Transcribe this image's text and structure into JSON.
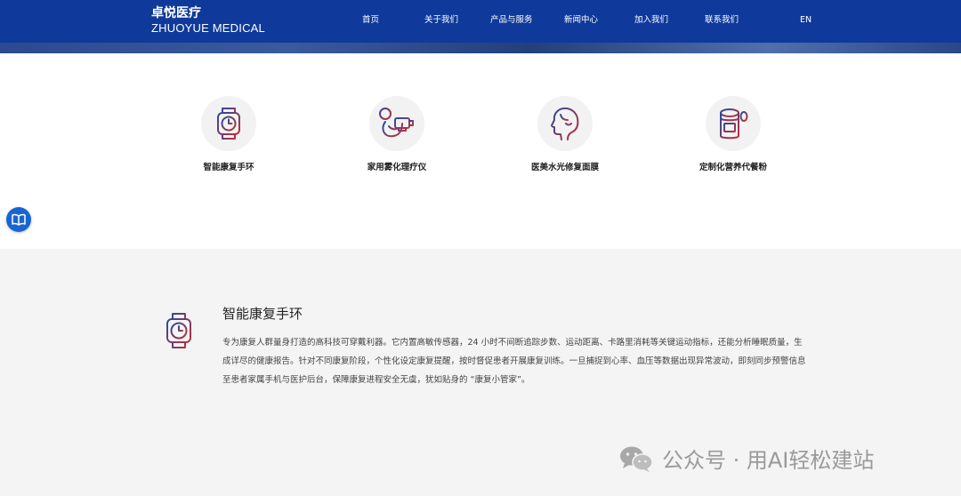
{
  "header": {
    "logo_cn": "卓悦医疗",
    "logo_en": "ZHUOYUE MEDICAL",
    "nav": [
      "首页",
      "关于我们",
      "产品与服务",
      "新闻中心",
      "加入我们",
      "联系我们",
      "EN"
    ]
  },
  "products": [
    {
      "label": "智能康复手环",
      "icon": "watch-icon"
    },
    {
      "label": "家用雾化理疗仪",
      "icon": "nebulizer-icon"
    },
    {
      "label": "医美水光修复面膜",
      "icon": "face-mask-icon"
    },
    {
      "label": "定制化营养代餐粉",
      "icon": "nutrition-jar-icon"
    }
  ],
  "float_button": {
    "icon": "book-icon"
  },
  "detail": {
    "title": "智能康复手环",
    "icon": "watch-icon",
    "description": "专为康复人群量身打造的高科技可穿戴利器。它内置高敏传感器，24 小时不间断追踪步数、运动距离、卡路里消耗等关键运动指标，还能分析睡眠质量，生成详尽的健康报告。针对不同康复阶段，个性化设定康复提醒，按时督促患者开展康复训练。一旦捕捉到心率、血压等数据出现异常波动，即刻同步预警信息至患者家属手机与医护后台，保障康复进程安全无虞，犹如贴身的 “康复小管家”。"
  },
  "watermark": {
    "text": "公众号 · 用AI轻松建站",
    "icon": "wechat-icon"
  },
  "colors": {
    "nav_blue": "#0f3a9b",
    "icon_gradient_start": "#2a4a9c",
    "icon_gradient_end": "#c0303a",
    "float_blue": "#1a64d2"
  }
}
